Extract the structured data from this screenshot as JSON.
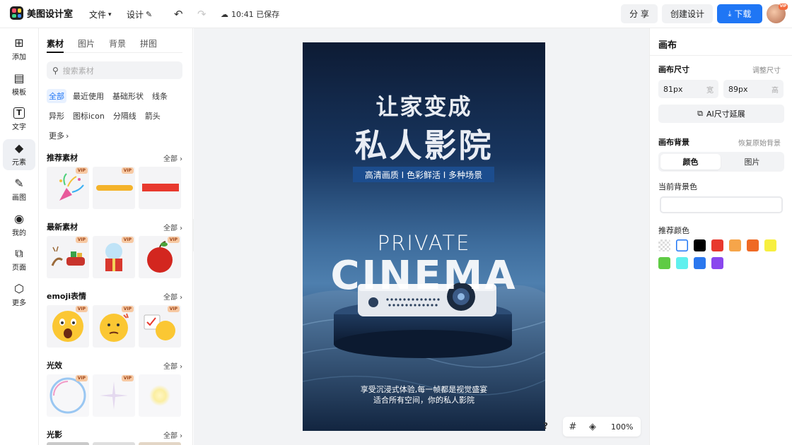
{
  "app": {
    "name": "美图设计室"
  },
  "topbar": {
    "file_menu": "文件",
    "design_menu": "设计",
    "save_status": "10:41 已保存",
    "share_label": "分 享",
    "create_label": "创建设计",
    "download_label": "下载",
    "avatar_badge": "VIP"
  },
  "rail": {
    "items": [
      {
        "label": "添加",
        "icon": "plus-square-icon"
      },
      {
        "label": "模板",
        "icon": "template-icon"
      },
      {
        "label": "文字",
        "icon": "text-icon"
      },
      {
        "label": "元素",
        "icon": "shapes-icon"
      },
      {
        "label": "画图",
        "icon": "draw-icon"
      },
      {
        "label": "我的",
        "icon": "user-icon"
      },
      {
        "label": "页面",
        "icon": "page-add-icon"
      },
      {
        "label": "更多",
        "icon": "cube-icon"
      }
    ],
    "active_index": 3
  },
  "panel": {
    "tabs": [
      "素材",
      "图片",
      "背景",
      "拼图"
    ],
    "search_placeholder": "搜索素材",
    "chips": [
      "全部",
      "最近使用",
      "基础形状",
      "线条",
      "异形",
      "图标icon",
      "分隔线",
      "箭头",
      "更多"
    ],
    "see_all": "全部",
    "vip": "VIP",
    "sections": [
      {
        "title": "推荐素材"
      },
      {
        "title": "最新素材"
      },
      {
        "title": "emoji表情"
      },
      {
        "title": "光效"
      },
      {
        "title": "光影"
      }
    ]
  },
  "poster": {
    "headline1": "让家变成",
    "headline2": "私人影院",
    "tagline": "高清画质 I 色彩鲜活 I 多种场景",
    "private": "PRIVATE",
    "cinema": "CINEMA",
    "footer1": "享受沉浸式体验,每一帧都是视觉盛宴",
    "footer2": "适合所有空间，你的私人影院"
  },
  "zoom": {
    "value": "100%",
    "help": "?"
  },
  "props": {
    "title": "画布",
    "size_label": "画布尺寸",
    "resize_link": "调整尺寸",
    "width_value": "81px",
    "width_unit": "宽",
    "height_value": "89px",
    "height_unit": "高",
    "ai_button": "AI尺寸延展",
    "bg_label": "画布背景",
    "reset_bg": "恢复原始背景",
    "seg_color": "颜色",
    "seg_image": "图片",
    "current_bg": "当前背景色",
    "recommend": "推荐颜色",
    "colors": [
      "transparent",
      "#ffffff",
      "#000000",
      "#e8392e",
      "#f6a54a",
      "#ef6a25",
      "#f7ef3f",
      "#5fcb45",
      "#5ff0ee",
      "#2b77ee",
      "#8a47ee"
    ]
  }
}
